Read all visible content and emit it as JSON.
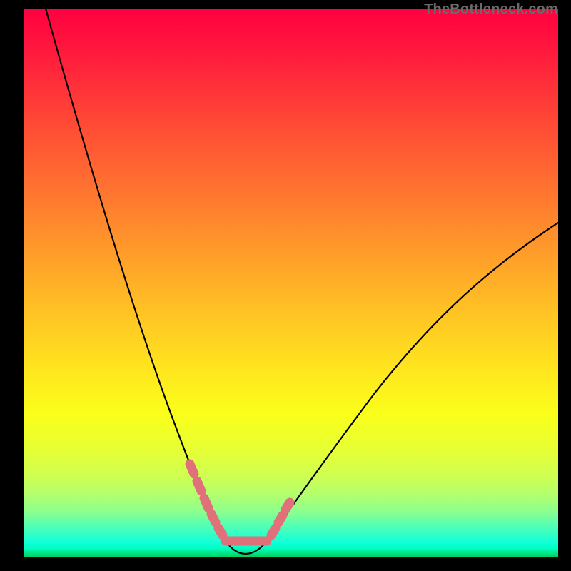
{
  "watermark": "TheBottleneck.com",
  "chart_data": {
    "type": "line",
    "title": "",
    "xlabel": "",
    "ylabel": "",
    "xlim": [
      0,
      100
    ],
    "ylim": [
      0,
      100
    ],
    "series": [
      {
        "name": "bottleneck-curve",
        "x": [
          4,
          8,
          12,
          16,
          20,
          24,
          28,
          30,
          32,
          34,
          36,
          38,
          40,
          42,
          44,
          60,
          70,
          80,
          90,
          100
        ],
        "y": [
          100,
          88,
          76,
          64,
          52,
          40,
          28,
          20,
          12,
          6,
          2,
          0,
          0,
          2,
          6,
          24,
          36,
          46,
          54,
          60
        ]
      }
    ],
    "highlight_segments": [
      {
        "name": "left-descent-pink",
        "x": [
          28,
          34
        ],
        "y": [
          22,
          4
        ]
      },
      {
        "name": "valley-floor-pink",
        "x": [
          34,
          42
        ],
        "y": [
          1,
          1
        ]
      },
      {
        "name": "right-ascent-pink",
        "x": [
          42,
          46
        ],
        "y": [
          4,
          10
        ]
      }
    ],
    "gradient_stops": [
      {
        "pos": 0,
        "color": "#ff0040"
      },
      {
        "pos": 50,
        "color": "#ffc524"
      },
      {
        "pos": 75,
        "color": "#f5ff1e"
      },
      {
        "pos": 100,
        "color": "#00d060"
      }
    ]
  }
}
